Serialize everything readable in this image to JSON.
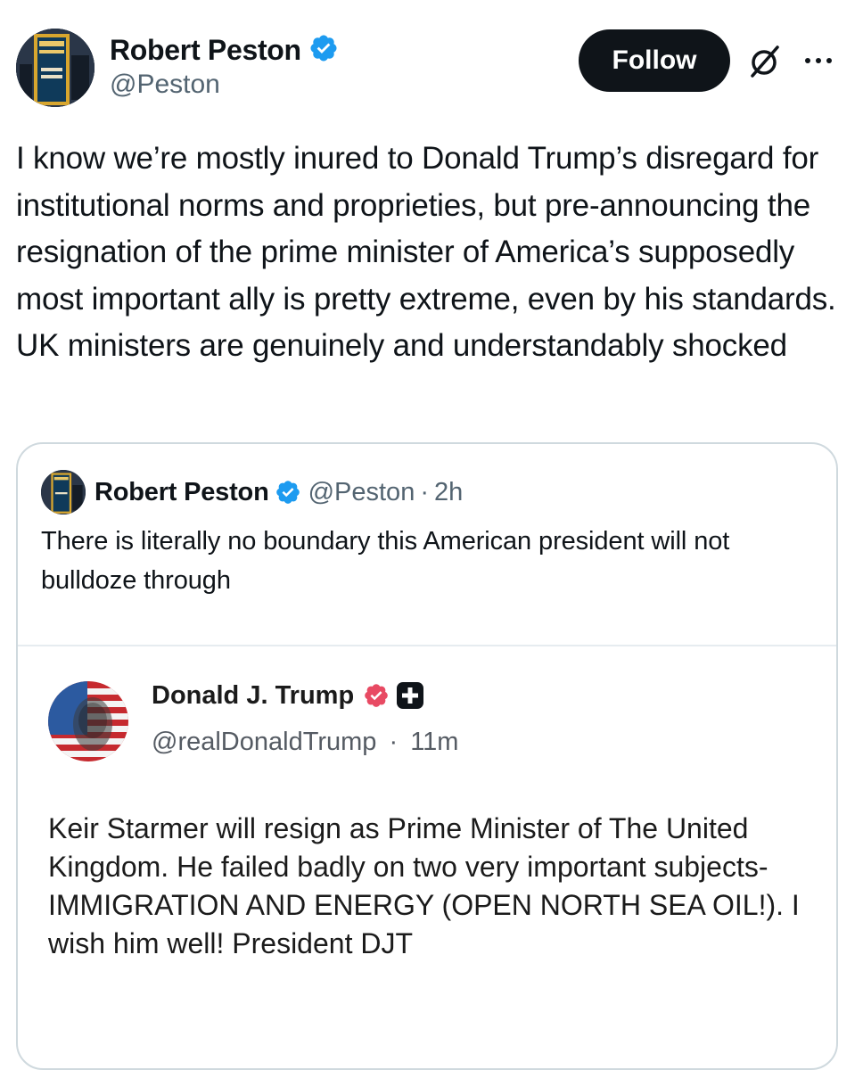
{
  "author": {
    "display_name": "Robert Peston",
    "handle": "@Peston",
    "verified_icon": "verified-badge-icon",
    "avatar_icon": "book-cover-avatar"
  },
  "actions": {
    "follow_label": "Follow",
    "grok_icon": "grok-icon",
    "more_icon": "more-icon"
  },
  "tweet": {
    "text": "I know we’re mostly inured to Donald Trump’s disregard for institutional norms and proprieties, but pre-announcing the resignation of the prime minister of America’s supposedly most important ally is pretty extreme, even by his standards.  UK ministers are genuinely and understandably shocked"
  },
  "quoted": {
    "display_name": "Robert Peston",
    "handle": "@Peston",
    "dot": "·",
    "time": "2h",
    "text": "There is literally no boundary this American president will not bulldoze through"
  },
  "embedded_post": {
    "display_name": "Donald J. Trump",
    "handle": "@realDonaldTrump",
    "dot": "·",
    "time": "11m",
    "text": "Keir Starmer will resign as Prime Minister of The United Kingdom. He failed badly on two very important subjects- IMMIGRATION AND ENERGY (OPEN NORTH SEA OIL!). I wish him well! President DJT"
  },
  "colors": {
    "verified_blue": "#1d9bf0",
    "truth_badge": "#e84a63",
    "text_primary": "#0f1419",
    "text_secondary": "#536471",
    "border": "#cfd9de"
  }
}
